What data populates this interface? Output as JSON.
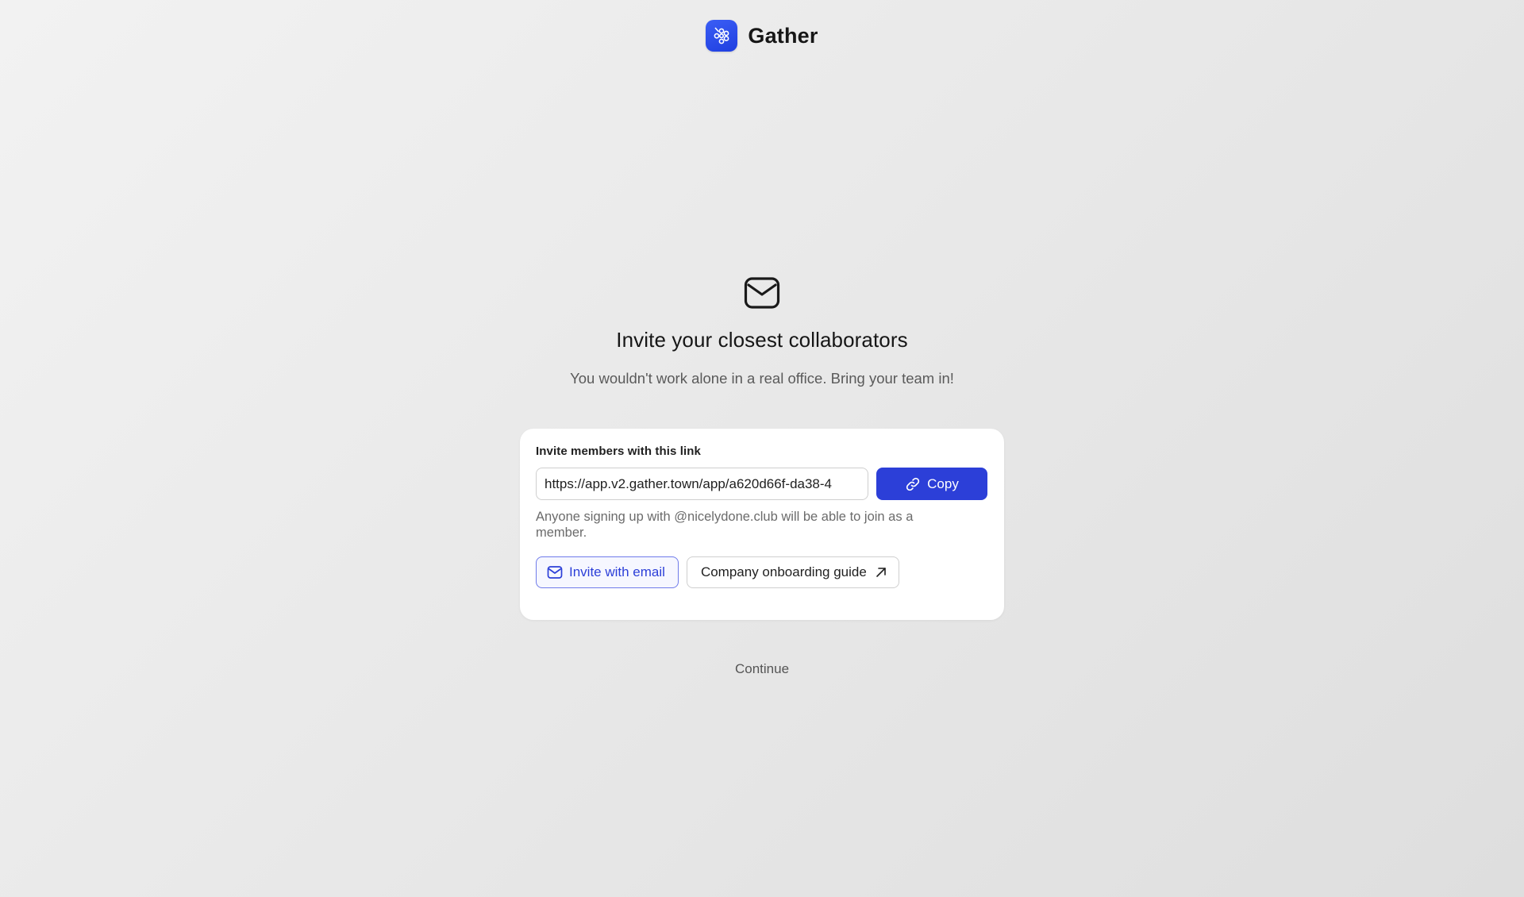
{
  "brand": {
    "name": "Gather",
    "logo_icon": "gather-logo-icon",
    "logo_color": "#2845e8"
  },
  "hero": {
    "icon": "envelope-icon",
    "title": "Invite your closest collaborators",
    "subtitle": "You wouldn't work alone in a real office. Bring your team in!"
  },
  "invite_card": {
    "label": "Invite members with this link",
    "link_value": "https://app.v2.gather.town/app/a620d66f-da38-4",
    "copy_label": "Copy",
    "copy_icon": "link-icon",
    "helper_text": "Anyone signing up with @nicelydone.club will be able to join as a member.",
    "invite_email_label": "Invite with email",
    "invite_email_icon": "mail-icon",
    "guide_label": "Company onboarding guide",
    "guide_icon": "arrow-up-right-icon"
  },
  "footer": {
    "continue_label": "Continue"
  },
  "colors": {
    "accent": "#2c3fd8",
    "accent_border": "#6f7bea",
    "background": "#e8e8e8",
    "card": "#ffffff"
  }
}
